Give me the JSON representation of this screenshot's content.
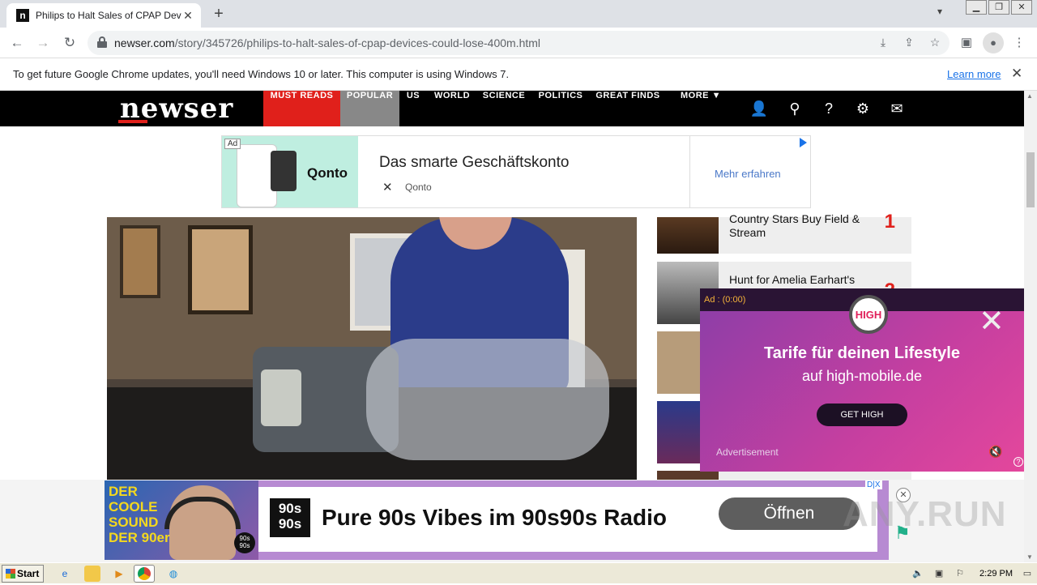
{
  "browser": {
    "tab_title": "Philips to Halt Sales of CPAP Devices",
    "tab_favicon": "n",
    "url_domain": "newser.com",
    "url_path": "/story/345726/philips-to-halt-sales-of-cpap-devices-could-lose-400m.html",
    "new_tab": "+",
    "close_tab": "✕"
  },
  "infobar": {
    "message": "To get future Google Chrome updates, you'll need Windows 10 or later. This computer is using Windows 7.",
    "link": "Learn more",
    "close": "✕"
  },
  "newser": {
    "logo": "newser",
    "nav": [
      "MUST READS",
      "POPULAR",
      "US",
      "WORLD",
      "SCIENCE",
      "POLITICS",
      "GREAT FINDS",
      "MORE ▼"
    ],
    "brand_red": "#e0201b"
  },
  "top_ad": {
    "tag": "Ad",
    "brand_logo": "Qonto",
    "title": "Das smarte Geschäftskonto",
    "x_icon": "✕",
    "brand": "Qonto",
    "cta": "Mehr erfahren"
  },
  "sidebar": [
    {
      "title": "Country Stars Buy Field & Stream",
      "num": "1"
    },
    {
      "title": "Hunt for Amelia Earhart's",
      "num": "2"
    }
  ],
  "float_ad": {
    "time": "Ad : (0:00)",
    "logo": "HIGH",
    "close": "✕",
    "headline": "Tarife für deinen Lifestyle",
    "sub": "auf high-mobile.de",
    "cta": "GET HIGH",
    "label": "Advertisement",
    "mute": "🔇",
    "help": "?"
  },
  "bottom_ad": {
    "left_text": "DER COOLE SOUND DER 90er",
    "badge": "90s 90s",
    "logo": "90s 90s",
    "title": "Pure 90s Vibes im 90s90s Radio",
    "cta": "Öffnen",
    "adchoice": "D|X",
    "close": "✕",
    "watermark": "ANY.RUN"
  },
  "taskbar": {
    "start": "Start",
    "clock": "2:29 PM"
  }
}
